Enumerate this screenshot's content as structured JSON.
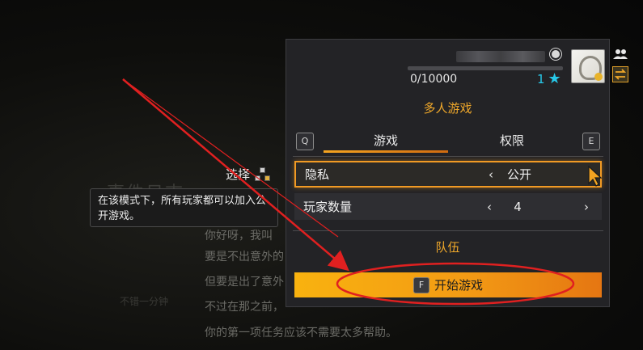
{
  "background": {
    "title": "事件日志",
    "lines": [
      "你好呀，我叫",
      "要是不出意外的",
      "但要是出了意外",
      "不过在那之前，",
      "你的第一项任务应该不需要太多帮助。"
    ],
    "side_text": "不错一分钟"
  },
  "select_hint": {
    "label": "选择"
  },
  "tooltip": {
    "text": "在该模式下，所有玩家都可以加入公开游戏。"
  },
  "profile": {
    "xp_text": "0/10000",
    "xp_fraction": 0.0,
    "level": "1",
    "icons": {
      "platform": "steam-icon",
      "rank": "star-icon"
    }
  },
  "panel": {
    "title": "多人游戏",
    "tab_left_key": "Q",
    "tab_right_key": "E",
    "tabs": [
      {
        "label": "游戏",
        "active": true
      },
      {
        "label": "权限",
        "active": false
      }
    ],
    "settings": [
      {
        "label": "隐私",
        "value": "公开",
        "selected": true
      },
      {
        "label": "玩家数量",
        "value": "4",
        "selected": false
      }
    ],
    "team_title": "队伍",
    "start_key": "F",
    "start_label": "开始游戏"
  },
  "colors": {
    "accent": "#f19a24",
    "level": "#27c8e8",
    "annotation": "#e02020"
  }
}
